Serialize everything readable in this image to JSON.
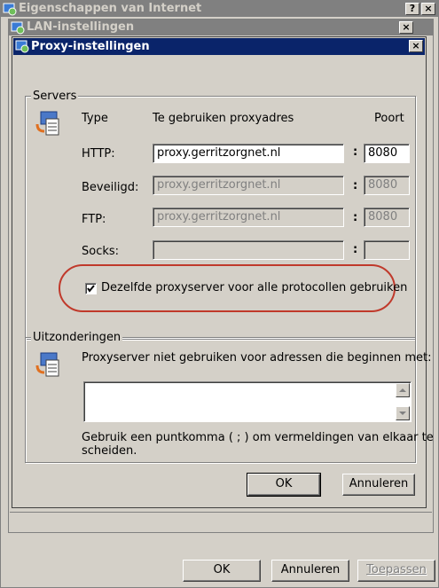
{
  "windows": {
    "outer_title": "Eigenschappen van Internet",
    "lan_title": "LAN-instellingen",
    "proxy_title": "Proxy-instellingen",
    "help_glyph": "?",
    "close_glyph": "×"
  },
  "servers": {
    "group_label": "Servers",
    "col_type": "Type",
    "col_address": "Te gebruiken proxyadres",
    "col_port": "Poort",
    "rows": [
      {
        "label": "HTTP:",
        "address": "proxy.gerritzorgnet.nl",
        "port": "8080",
        "enabled": true
      },
      {
        "label": "Beveiligd:",
        "address": "proxy.gerritzorgnet.nl",
        "port": "8080",
        "enabled": false
      },
      {
        "label": "FTP:",
        "address": "proxy.gerritzorgnet.nl",
        "port": "8080",
        "enabled": false
      },
      {
        "label": "Socks:",
        "address": "",
        "port": "",
        "enabled": true
      }
    ],
    "separator": ":",
    "same_proxy_label": "Dezelfde proxyserver voor alle protocollen gebruiken",
    "same_proxy_checked": true,
    "highlight_color": "#c0392b"
  },
  "exceptions": {
    "group_label": "Uitzonderingen",
    "description": "Proxyserver niet gebruiken voor adressen die beginnen met:",
    "value": "",
    "hint_line1": "Gebruik een puntkomma ( ; ) om vermeldingen van elkaar te",
    "hint_line2": "scheiden."
  },
  "proxy_buttons": {
    "ok": "OK",
    "cancel": "Annuleren"
  },
  "outer_buttons": {
    "ok": "OK",
    "cancel": "Annuleren",
    "apply": "Toepassen"
  },
  "colors": {
    "title_active": "#0a246a",
    "title_inactive": "#808080",
    "face": "#d4d0c8"
  }
}
